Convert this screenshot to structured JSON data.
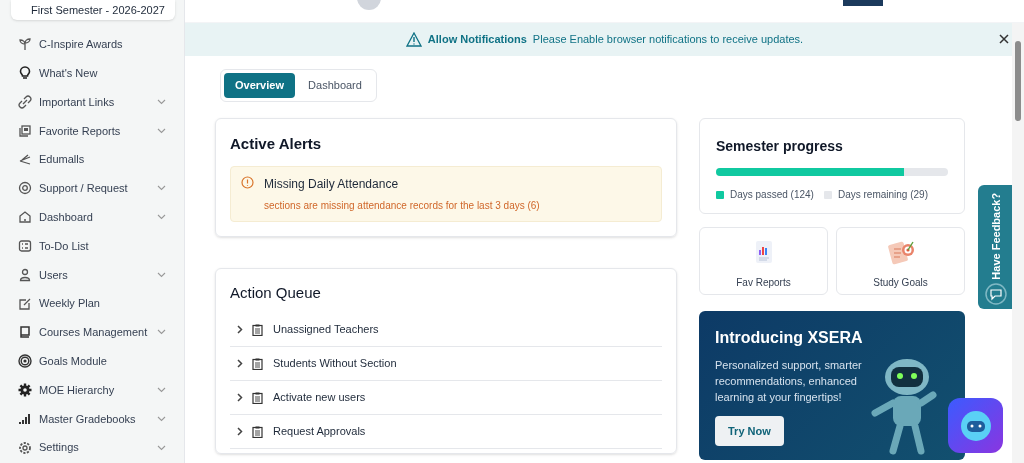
{
  "semester_select": {
    "value": "First Semester - 2026-2027"
  },
  "sidebar": {
    "items": [
      {
        "label": "C-Inspire Awards",
        "expandable": false
      },
      {
        "label": "What's New",
        "expandable": false
      },
      {
        "label": "Important Links",
        "expandable": true
      },
      {
        "label": "Favorite Reports",
        "expandable": true
      },
      {
        "label": "Edumalls",
        "expandable": false
      },
      {
        "label": "Support / Request",
        "expandable": true
      },
      {
        "label": "Dashboard",
        "expandable": true
      },
      {
        "label": "To-Do List",
        "expandable": false
      },
      {
        "label": "Users",
        "expandable": true
      },
      {
        "label": "Weekly Plan",
        "expandable": false
      },
      {
        "label": "Courses Management",
        "expandable": true
      },
      {
        "label": "Goals Module",
        "expandable": false
      },
      {
        "label": "MOE Hierarchy",
        "expandable": true
      },
      {
        "label": "Master Gradebooks",
        "expandable": true
      },
      {
        "label": "Settings",
        "expandable": true
      }
    ]
  },
  "notification": {
    "title": "Allow Notifications",
    "message": "Please Enable browser notifications to receive updates."
  },
  "tabs": [
    {
      "label": "Overview",
      "selected": true
    },
    {
      "label": "Dashboard",
      "selected": false
    }
  ],
  "active_alerts": {
    "title": "Active Alerts",
    "alerts": [
      {
        "title": "Missing Daily Attendance",
        "detail": "sections are missing attendance records for the last 3 days (6)"
      }
    ]
  },
  "action_queue": {
    "title": "Action Queue",
    "items": [
      {
        "label": "Unassigned Teachers",
        "expanded": false
      },
      {
        "label": "Students Without Section",
        "expanded": false
      },
      {
        "label": "Activate new users",
        "expanded": false
      },
      {
        "label": "Request Approvals",
        "expanded": false
      }
    ]
  },
  "semester_progress": {
    "title": "Semester progress",
    "level": 0.81,
    "legend": [
      {
        "label": "Days passed (124)",
        "color": "#10c9a0"
      },
      {
        "label": "Days remaining (29)",
        "color": "#e5e7eb"
      }
    ]
  },
  "shortcuts": [
    {
      "label": "Fav Reports",
      "kind": "reports"
    },
    {
      "label": "Study Goals",
      "kind": "goals"
    }
  ],
  "promo": {
    "title": "Introducing XSERA",
    "text": "Personalized support, smarter recommendations, enhanced learning at your fingertips!",
    "button": "Try Now"
  },
  "feedback_tab": {
    "label": "Have Feedback?"
  }
}
